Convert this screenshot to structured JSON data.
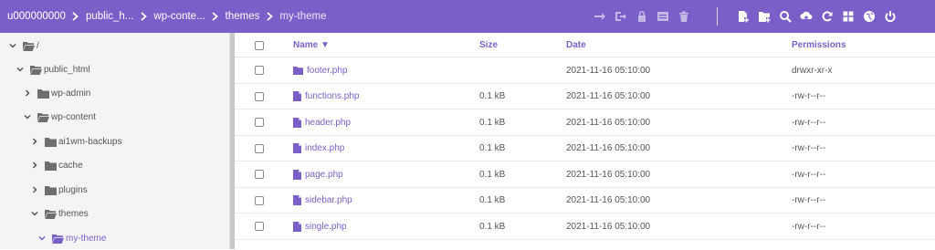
{
  "breadcrumb": [
    "u000000000",
    "public_h...",
    "wp-conte...",
    "themes",
    "my-theme"
  ],
  "toolbar": {
    "disabled": [
      "move-icon",
      "sign-out-icon",
      "lock-icon",
      "archive-icon",
      "trash-icon"
    ],
    "enabled": [
      "new-file-icon",
      "new-folder-icon",
      "search-icon",
      "upload-icon",
      "refresh-icon",
      "grid-view-icon",
      "globe-icon",
      "power-icon"
    ]
  },
  "tree": [
    {
      "label": "/",
      "expanded": true
    },
    {
      "label": "public_html",
      "expanded": true
    },
    {
      "label": "wp-admin",
      "expanded": false
    },
    {
      "label": "wp-content",
      "expanded": true
    },
    {
      "label": "ai1wm-backups",
      "expanded": false
    },
    {
      "label": "cache",
      "expanded": false
    },
    {
      "label": "plugins",
      "expanded": false
    },
    {
      "label": "themes",
      "expanded": true
    },
    {
      "label": "my-theme",
      "expanded": true,
      "active": true
    }
  ],
  "columns": {
    "name": "Name ▼",
    "size": "Size",
    "date": "Date",
    "permissions": "Permissions"
  },
  "files": [
    {
      "name": "footer.php",
      "type": "folder",
      "size": "",
      "date": "2021-11-16 05:10:00",
      "permissions": "drwxr-xr-x"
    },
    {
      "name": "functions.php",
      "type": "file",
      "size": "0.1 kB",
      "date": "2021-11-16 05:10:00",
      "permissions": "-rw-r--r--"
    },
    {
      "name": "header.php",
      "type": "file",
      "size": "0.1 kB",
      "date": "2021-11-16 05:10:00",
      "permissions": "-rw-r--r--"
    },
    {
      "name": "index.php",
      "type": "file",
      "size": "0.1 kB",
      "date": "2021-11-16 05:10:00",
      "permissions": "-rw-r--r--"
    },
    {
      "name": "page.php",
      "type": "file",
      "size": "0.1 kB",
      "date": "2021-11-16 05:10:00",
      "permissions": "-rw-r--r--"
    },
    {
      "name": "sidebar.php",
      "type": "file",
      "size": "0.1 kB",
      "date": "2021-11-16 05:10:00",
      "permissions": "-rw-r--r--"
    },
    {
      "name": "single.php",
      "type": "file",
      "size": "0.1 kB",
      "date": "2021-11-16 05:10:00",
      "permissions": "-rw-r--r--"
    }
  ],
  "colors": {
    "accent": "#7b5fc9",
    "sidebar_bg": "#f4f4f4"
  }
}
